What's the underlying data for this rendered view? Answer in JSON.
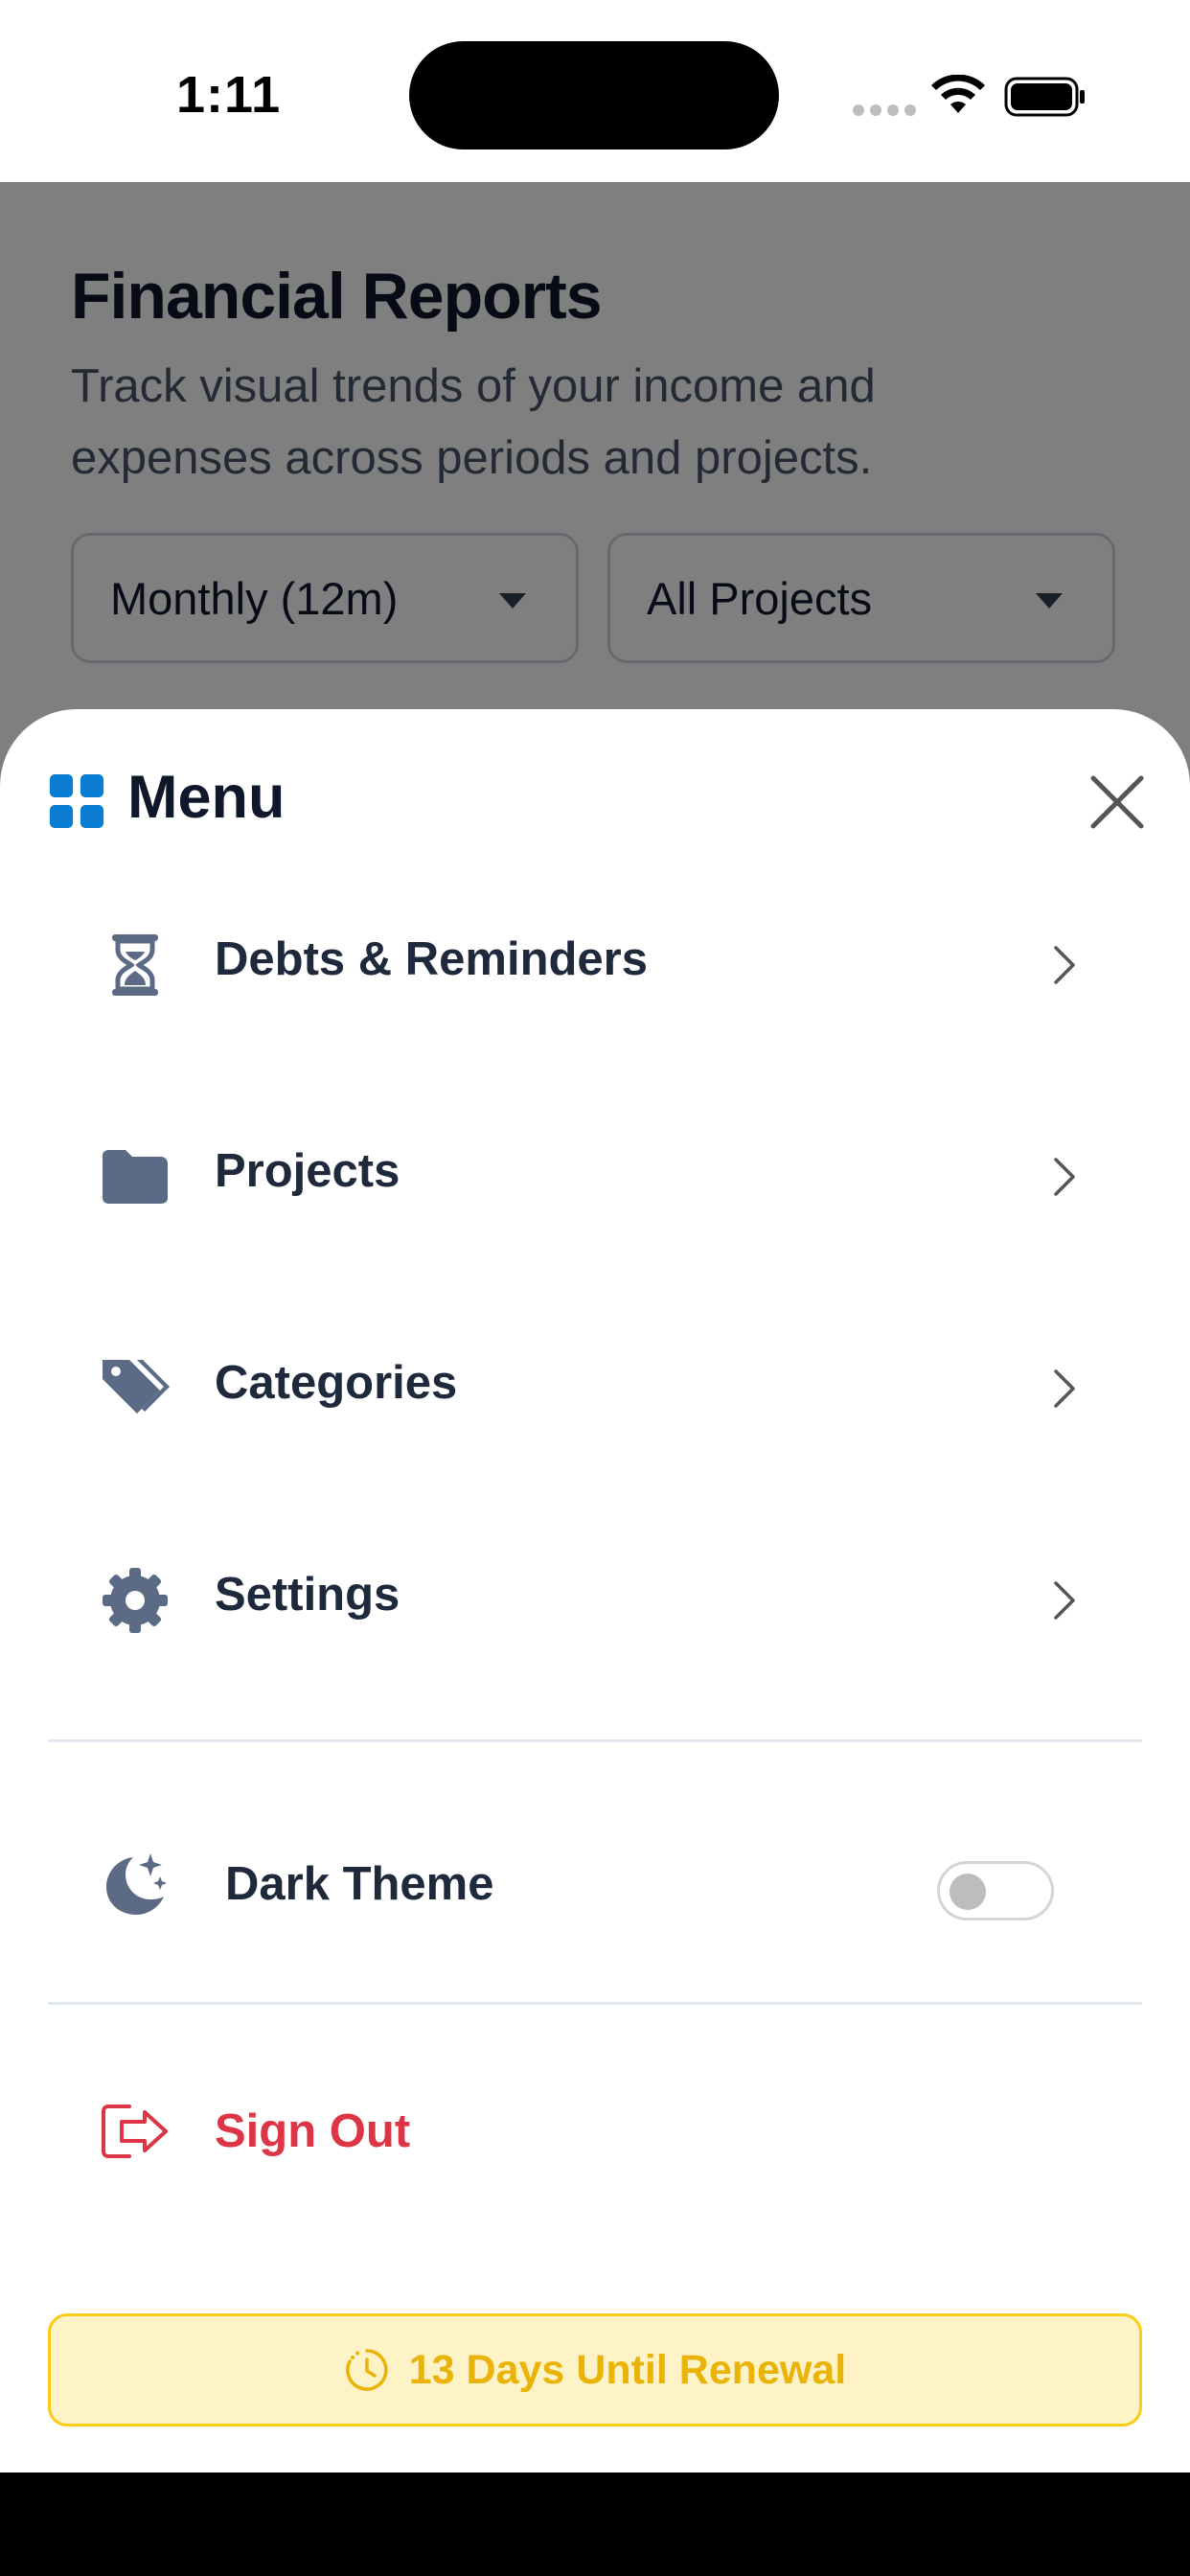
{
  "status_bar": {
    "time": "1:11"
  },
  "background": {
    "title": "Financial Reports",
    "subtitle": "Track visual trends of your income and expenses across periods and projects.",
    "period_select": "Monthly (12m)",
    "project_select": "All Projects"
  },
  "menu": {
    "title": "Menu",
    "items": [
      {
        "label": "Debts & Reminders",
        "icon": "hourglass-icon"
      },
      {
        "label": "Projects",
        "icon": "folder-icon"
      },
      {
        "label": "Categories",
        "icon": "tags-icon"
      },
      {
        "label": "Settings",
        "icon": "gear-icon"
      }
    ],
    "dark_theme": {
      "label": "Dark Theme",
      "enabled": false
    },
    "sign_out": {
      "label": "Sign Out"
    },
    "renewal": {
      "label": "13 Days Until Renewal"
    }
  },
  "colors": {
    "accent": "#0a7bd3",
    "icon": "#5b6b85",
    "danger": "#dc3545",
    "warning": "#eab308",
    "warning_bg": "#fef3c7"
  }
}
